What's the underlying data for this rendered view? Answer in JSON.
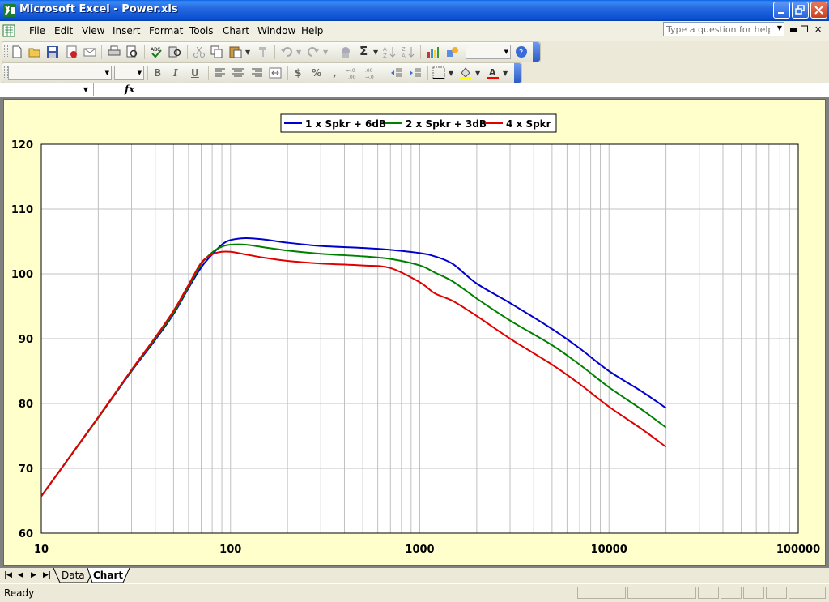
{
  "window": {
    "title": "Microsoft Excel - Power.xls"
  },
  "menu": [
    "File",
    "Edit",
    "View",
    "Insert",
    "Format",
    "Tools",
    "Chart",
    "Window",
    "Help"
  ],
  "ask_placeholder": "Type a question for help",
  "formula_fx": "fx",
  "sheets": {
    "tabs": [
      "Data",
      "Chart"
    ],
    "active": "Chart"
  },
  "status": {
    "text": "Ready"
  },
  "colors": {
    "series1": "#0000cc",
    "series2": "#008000",
    "series3": "#e00000",
    "chart_bg": "#ffffcc"
  },
  "chart_data": {
    "type": "line",
    "x_scale": "log",
    "xlim": [
      10,
      100000
    ],
    "ylim": [
      60,
      120
    ],
    "x_ticks": [
      "10",
      "100",
      "1000",
      "10000",
      "100000"
    ],
    "y_ticks": [
      "60",
      "70",
      "80",
      "90",
      "100",
      "110",
      "120"
    ],
    "grid": true,
    "legend_position": "top-center",
    "series": [
      {
        "name": "1 x Spkr + 6dB",
        "x": [
          10,
          20,
          30,
          40,
          50,
          60,
          70,
          80,
          90,
          100,
          120,
          150,
          200,
          300,
          500,
          700,
          1000,
          1200,
          1500,
          2000,
          3000,
          5000,
          7000,
          10000,
          15000,
          20000
        ],
        "y": [
          65.7,
          77.8,
          85,
          89.8,
          93.8,
          97.8,
          101,
          103,
          104.5,
          105.2,
          105.5,
          105.3,
          104.8,
          104.3,
          104,
          103.7,
          103.2,
          102.7,
          101.5,
          98.5,
          95.5,
          91.5,
          88.5,
          85,
          81.8,
          79.3
        ]
      },
      {
        "name": "2 x Spkr + 3dB",
        "x": [
          10,
          20,
          30,
          40,
          50,
          60,
          70,
          80,
          90,
          100,
          120,
          150,
          200,
          300,
          500,
          700,
          1000,
          1200,
          1500,
          2000,
          3000,
          5000,
          7000,
          10000,
          15000,
          20000
        ],
        "y": [
          65.7,
          77.8,
          85.1,
          90,
          94,
          98,
          101.5,
          103.3,
          104.2,
          104.5,
          104.5,
          104.1,
          103.6,
          103.1,
          102.7,
          102.3,
          101.3,
          100.2,
          98.8,
          96.2,
          92.8,
          89,
          86,
          82.5,
          79,
          76.3
        ]
      },
      {
        "name": "4 x Spkr",
        "x": [
          10,
          20,
          30,
          40,
          50,
          60,
          70,
          80,
          90,
          100,
          120,
          150,
          200,
          300,
          500,
          700,
          1000,
          1200,
          1500,
          2000,
          3000,
          5000,
          7000,
          10000,
          15000,
          20000
        ],
        "y": [
          65.7,
          77.9,
          85.2,
          90.2,
          94.3,
          98.3,
          101.7,
          103,
          103.4,
          103.4,
          103,
          102.5,
          102,
          101.6,
          101.3,
          100.9,
          98.7,
          97,
          95.8,
          93.5,
          90,
          86,
          83,
          79.5,
          76,
          73.3
        ]
      }
    ]
  }
}
